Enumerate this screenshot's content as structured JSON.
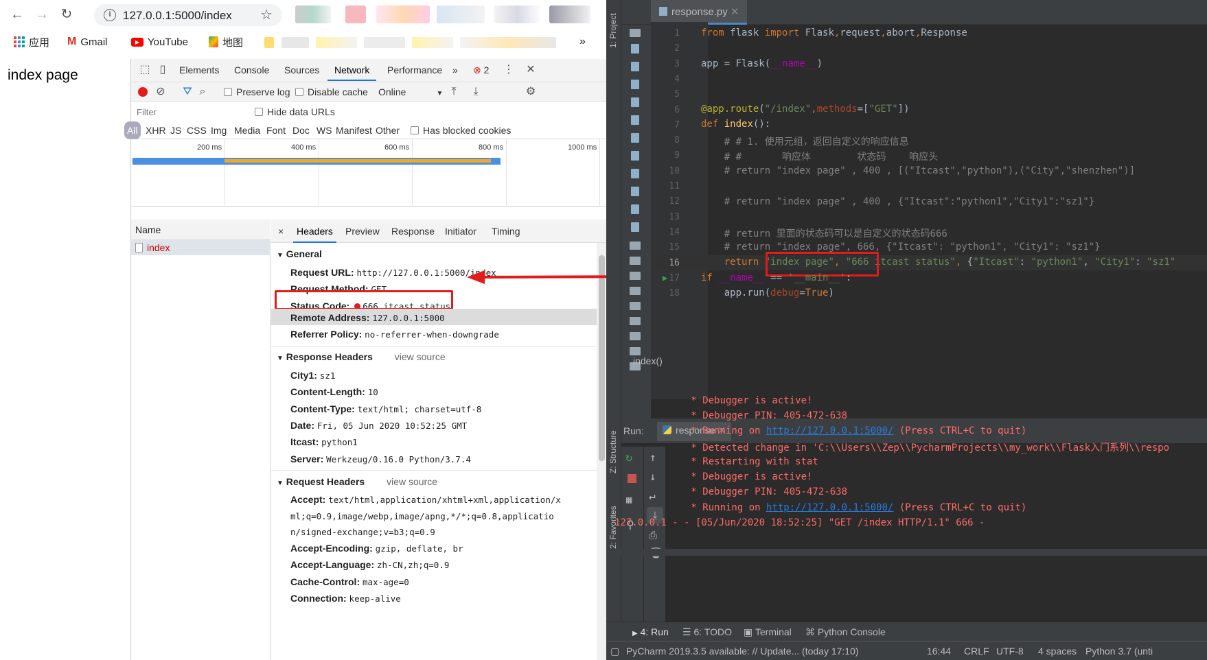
{
  "browser": {
    "url": "127.0.0.1:5000/index",
    "bookmarks": [
      "应用",
      "Gmail",
      "YouTube",
      "地图"
    ],
    "more_bookmarks": "»",
    "page_heading": "index page"
  },
  "devtools": {
    "tabs": [
      "Elements",
      "Console",
      "Sources",
      "Network",
      "Performance",
      "»"
    ],
    "active_tab": "Network",
    "error_count": "2",
    "toolbar": {
      "preserve_log": "Preserve log",
      "disable_cache": "Disable cache",
      "throttle": "Online"
    },
    "filter_placeholder": "Filter",
    "hide_data_urls": "Hide data URLs",
    "filter_types": [
      "All",
      "XHR",
      "JS",
      "CSS",
      "Img",
      "Media",
      "Font",
      "Doc",
      "WS",
      "Manifest",
      "Other"
    ],
    "has_blocked_cookies": "Has blocked cookies",
    "timeline_ticks": [
      "200 ms",
      "400 ms",
      "600 ms",
      "800 ms",
      "1000 ms"
    ],
    "name_header": "Name",
    "requests": [
      "index"
    ],
    "detail_tabs": [
      "Headers",
      "Preview",
      "Response",
      "Initiator",
      "Timing"
    ],
    "close_symbol": "×",
    "general": {
      "title": "General",
      "request_url_label": "Request URL:",
      "request_url": "http://127.0.0.1:5000/index",
      "request_method_label": "Request Method:",
      "request_method": "GET",
      "status_code_label": "Status Code:",
      "status_code": "666 itcast status",
      "remote_address_label": "Remote Address:",
      "remote_address": "127.0.0.1:5000",
      "referrer_policy_label": "Referrer Policy:",
      "referrer_policy": "no-referrer-when-downgrade"
    },
    "response_headers": {
      "title": "Response Headers",
      "view_source": "view source",
      "items": [
        {
          "k": "City1:",
          "v": "sz1"
        },
        {
          "k": "Content-Length:",
          "v": "10"
        },
        {
          "k": "Content-Type:",
          "v": "text/html; charset=utf-8"
        },
        {
          "k": "Date:",
          "v": "Fri, 05 Jun 2020 10:52:25 GMT"
        },
        {
          "k": "Itcast:",
          "v": "python1"
        },
        {
          "k": "Server:",
          "v": "Werkzeug/0.16.0 Python/3.7.4"
        }
      ]
    },
    "request_headers": {
      "title": "Request Headers",
      "view_source": "view source",
      "accept_label": "Accept:",
      "accept_lines": [
        "text/html,application/xhtml+xml,application/x",
        "ml;q=0.9,image/webp,image/apng,*/*;q=0.8,applicatio",
        "n/signed-exchange;v=b3;q=0.9"
      ],
      "items": [
        {
          "k": "Accept-Encoding:",
          "v": "gzip, deflate, br"
        },
        {
          "k": "Accept-Language:",
          "v": "zh-CN,zh;q=0.9"
        },
        {
          "k": "Cache-Control:",
          "v": "max-age=0"
        },
        {
          "k": "Connection:",
          "v": "keep-alive"
        }
      ]
    }
  },
  "pycharm": {
    "project_label": "1: Project",
    "structure_label": "Z: Structure",
    "favorites_label": "2: Favorites",
    "file_tab": "response.py",
    "line_numbers": [
      "1",
      "2",
      "3",
      "4",
      "5",
      "6",
      "7",
      "8",
      "9",
      "10",
      "11",
      "12",
      "13",
      "14",
      "15",
      "16",
      "17",
      "18"
    ],
    "breadcrumb": "index()",
    "run_label": "Run:",
    "run_tab": "response",
    "console_lines": [
      " * Debugger is active!",
      " * Debugger PIN: 405-472-638",
      " * Running on ",
      " * Detected change in 'C:\\\\Users\\\\Zep\\\\PycharmProjects\\\\my_work\\\\Flask入门系列\\\\respo",
      " * Restarting with stat",
      " * Debugger is active!",
      " * Debugger PIN: 405-472-638",
      " * Running on ",
      "127.0.0.1 - - [05/Jun/2020 18:52:25] \"GET /index HTTP/1.1\" 666 -"
    ],
    "run_url": "http://127.0.0.1:5000/",
    "run_suffix": " (Press CTRL+C to quit)",
    "bottom_tabs": [
      "4: Run",
      "6: TODO",
      "Terminal",
      "Python Console"
    ],
    "status_message": "PyCharm 2019.3.5 available: // Update... (today 17:10)",
    "status_items": [
      "16:44",
      "CRLF",
      "UTF-8",
      "4 spaces",
      "Python 3.7 (unti"
    ]
  },
  "colors": {
    "accent": "#1a73e8",
    "highlight_red": "#e31b1b",
    "pycharm_bg": "#2b2b2b"
  }
}
